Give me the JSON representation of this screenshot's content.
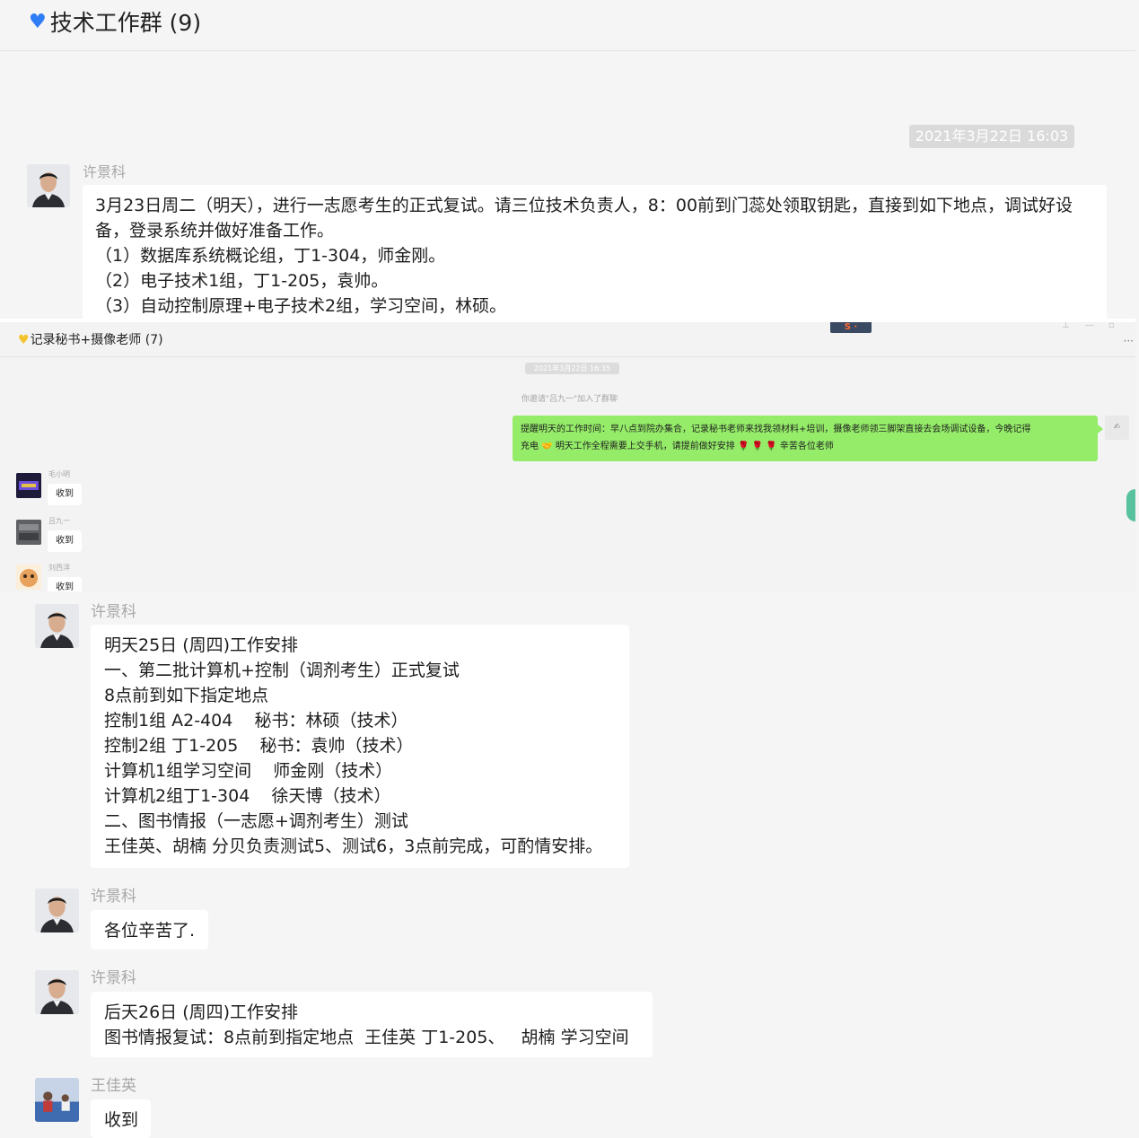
{
  "section1": {
    "group_title": "技术工作群 (9)",
    "timestamp": "2021年3月22日 16:03",
    "message": {
      "sender": "许景科",
      "lines": [
        "3月23日周二（明天），进行一志愿考生的正式复试。请三位技术负责人，8：00前到门蕊处领取钥匙，直接到如下地点，调试好设",
        "备，登录系统并做好准备工作。",
        "（1）数据库系统概论组，丁1-304，师金刚。",
        "（2）电子技术1组，丁1-205，袁帅。",
        "（3）自动控制原理+电子技术2组，学习空间，林硕。"
      ]
    }
  },
  "section2": {
    "group_title": "记录秘书+摄像老师 (7)",
    "timestamp": "2021年3月22日 16:35",
    "system_notice": "你邀请\"吕九一\"加入了群聊",
    "my_message": {
      "line1": "提醒明天的工作时间：早八点到院办集合，记录秘书老师来找我领材料+培训，摄像老师领三脚架直接去会场调试设备，今晚记得",
      "line2_a": "充电",
      "line2_b": "明天工作全程需要上交手机，请提前做好安排",
      "line2_c": "辛苦各位老师"
    },
    "replies": [
      {
        "sender": "毛小明",
        "text": "收到"
      },
      {
        "sender": "吕九一",
        "text": "收到"
      },
      {
        "sender": "刘西洋",
        "text": "收到"
      }
    ]
  },
  "section3": {
    "messages": [
      {
        "sender": "许景科",
        "lines": [
          "明天25日 (周四)工作安排",
          "一、第二批计算机+控制（调剂考生）正式复试",
          "8点前到如下指定地点",
          "控制1组 A2-404    秘书：林硕（技术）",
          "控制2组 丁1-205    秘书：袁帅（技术）",
          "计算机1组学习空间    师金刚（技术）",
          "计算机2组丁1-304    徐天博（技术）",
          "二、图书情报（一志愿+调剂考生）测试",
          "王佳英、胡楠 分贝负责测试5、测试6，3点前完成，可酌情安排。"
        ]
      },
      {
        "sender": "许景科",
        "lines": [
          "各位辛苦了."
        ]
      },
      {
        "sender": "许景科",
        "lines": [
          "后天26日 (周四)工作安排",
          "图书情报复试：8点前到指定地点  王佳英 丁1-205、   胡楠 学习空间"
        ]
      },
      {
        "sender": "王佳英",
        "lines": [
          "收到"
        ]
      }
    ]
  },
  "colors": {
    "chat_bg": "#f5f5f5",
    "bubble_white": "#ffffff",
    "bubble_green": "#95ec69",
    "timestamp_pill": "#dadada",
    "sender_gray": "#a8a8a8"
  }
}
